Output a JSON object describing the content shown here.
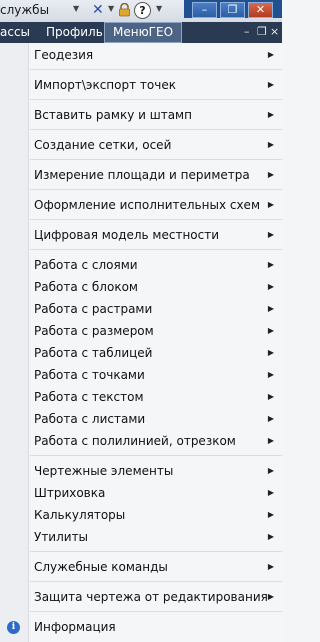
{
  "toolbar": {
    "services_label": "службы",
    "help_glyph": "?"
  },
  "window_controls": {
    "minimize": "–",
    "restore": "❐",
    "close": "✕"
  },
  "menubar": {
    "items": [
      "ассы",
      "Профиль",
      "МенюГЕО"
    ],
    "doc_controls": [
      "–",
      "❐",
      "×"
    ]
  },
  "menu": {
    "items": [
      {
        "label": "Геодезия",
        "submenu": true
      },
      {
        "label": "Импорт\\экспорт точек",
        "submenu": true
      },
      {
        "label": "Вставить рамку и штамп",
        "submenu": true
      },
      {
        "label": "Создание сетки, осей",
        "submenu": true
      },
      {
        "label": "Измерение площади и периметра",
        "submenu": true
      },
      {
        "label": "Оформление исполнительных схем",
        "submenu": true
      },
      {
        "label": "Цифровая модель местности",
        "submenu": true
      },
      {
        "label": "Работа с слоями",
        "submenu": true
      },
      {
        "label": "Работа с блоком",
        "submenu": true
      },
      {
        "label": "Работа с растрами",
        "submenu": true
      },
      {
        "label": "Работа с размером",
        "submenu": true
      },
      {
        "label": "Работа с таблицей",
        "submenu": true
      },
      {
        "label": "Работа с точками",
        "submenu": true
      },
      {
        "label": "Работа с текстом",
        "submenu": true
      },
      {
        "label": "Работа с листами",
        "submenu": true
      },
      {
        "label": "Работа с полилинией, отрезком",
        "submenu": true
      },
      {
        "label": "Чертежные элементы",
        "submenu": true
      },
      {
        "label": "Штриховка",
        "submenu": true
      },
      {
        "label": "Калькуляторы",
        "submenu": true
      },
      {
        "label": "Утилиты",
        "submenu": true
      },
      {
        "label": "Служебные команды",
        "submenu": true
      },
      {
        "label": "Защита чертежа от редактирования",
        "submenu": true
      },
      {
        "label": "Информация",
        "submenu": false,
        "icon": "info-icon"
      }
    ],
    "arrow_glyph": "▶",
    "info_glyph": "i"
  }
}
